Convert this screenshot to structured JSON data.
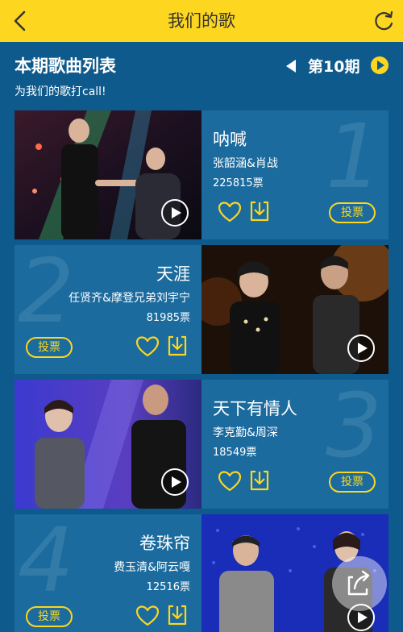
{
  "header": {
    "title": "我们的歌",
    "back_icon": "chevron-left-icon",
    "refresh_icon": "refresh-icon"
  },
  "list": {
    "title": "本期歌曲列表",
    "subtitle": "为我们的歌打call!",
    "period_label": "第10期"
  },
  "songs": [
    {
      "rank": "1",
      "name": "呐喊",
      "artist": "张韶涵&肖战",
      "votes": "225815票",
      "vote_label": "投票"
    },
    {
      "rank": "2",
      "name": "天涯",
      "artist": "任贤齐&摩登兄弟刘宇宁",
      "votes": "81985票",
      "vote_label": "投票"
    },
    {
      "rank": "3",
      "name": "天下有情人",
      "artist": "李克勤&周深",
      "votes": "18549票",
      "vote_label": "投票"
    },
    {
      "rank": "4",
      "name": "卷珠帘",
      "artist": "费玉清&阿云嘎",
      "votes": "12516票",
      "vote_label": "投票"
    }
  ],
  "colors": {
    "background": "#0f5a8c",
    "card": "#1b6b9e",
    "accent": "#fcd61f"
  }
}
